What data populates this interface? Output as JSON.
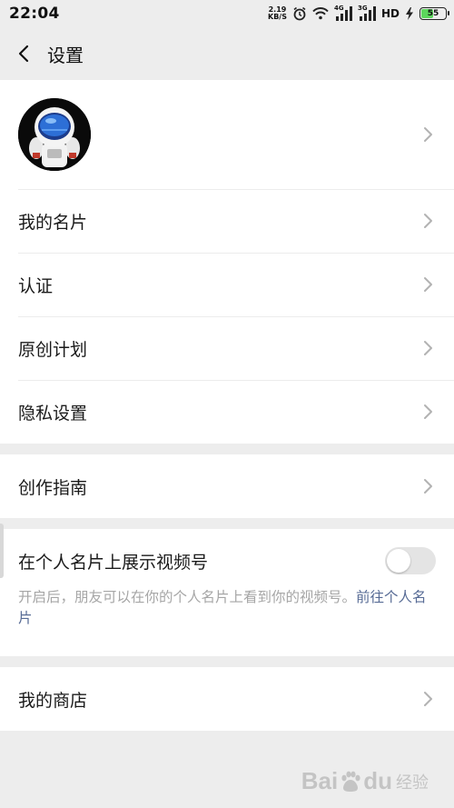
{
  "status_bar": {
    "time": "22:04",
    "net_speed_value": "2.19",
    "net_speed_unit": "KB/S",
    "signal1_label": "4G",
    "signal2_label": "3G",
    "hd_label": "HD",
    "battery_level": "55",
    "battery_fraction": 0.55,
    "battery_color": "#5cd65c"
  },
  "navbar": {
    "title": "设置"
  },
  "group1": {
    "items": [
      {
        "label": "我的名片"
      },
      {
        "label": "认证"
      },
      {
        "label": "原创计划"
      },
      {
        "label": "隐私设置"
      }
    ]
  },
  "group2": {
    "items": [
      {
        "label": "创作指南"
      }
    ]
  },
  "toggle_section": {
    "label": "在个人名片上展示视频号",
    "enabled": false,
    "description": "开启后，朋友可以在你的个人名片上看到你的视频号。",
    "link_text": "前往个人名片"
  },
  "group3": {
    "items": [
      {
        "label": "我的商店"
      }
    ]
  },
  "watermark": {
    "brand": "Bai",
    "brand_suffix": "du",
    "cn": "经验"
  },
  "colors": {
    "link": "#576b95",
    "background": "#ededed"
  }
}
